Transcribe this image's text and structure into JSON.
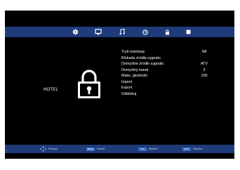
{
  "top_bar": {
    "tabs": [
      {
        "icon": "gear-icon",
        "active": true
      },
      {
        "icon": "monitor-icon"
      },
      {
        "icon": "music-note-icon"
      },
      {
        "icon": "clock-icon"
      },
      {
        "icon": "lock-icon"
      },
      {
        "icon": "square-icon"
      }
    ]
  },
  "left_panel": {
    "label": "HOTEL",
    "icon": "padlock-icon"
  },
  "menu": {
    "items": [
      {
        "label": "Tryb hotelowy",
        "value": "Wł"
      },
      {
        "label": "Blokada źródła sygnału",
        "value": ""
      },
      {
        "label": "Domyślne źródło sygnału",
        "value": "ATV"
      },
      {
        "label": "Domyślny kanał",
        "value": "3"
      },
      {
        "label": "Maks. głośność",
        "value": "100"
      },
      {
        "label": "Import",
        "value": ""
      },
      {
        "label": "Export",
        "value": ""
      },
      {
        "label": "Odblokuj",
        "value": ""
      }
    ]
  },
  "bottom_bar": {
    "hints": [
      {
        "key": "",
        "key_icon": "dpad-icon",
        "label": "Przesuń"
      },
      {
        "key": "MENU",
        "label": "Powrót"
      },
      {
        "key": "OK",
        "label": "Wybierz"
      },
      {
        "key": "EXIT",
        "label": "Zakończ"
      }
    ]
  },
  "colors": {
    "bar": "#1f3b7a",
    "background": "#000000",
    "text": "#ffffff",
    "key": "#3f6fc9"
  }
}
